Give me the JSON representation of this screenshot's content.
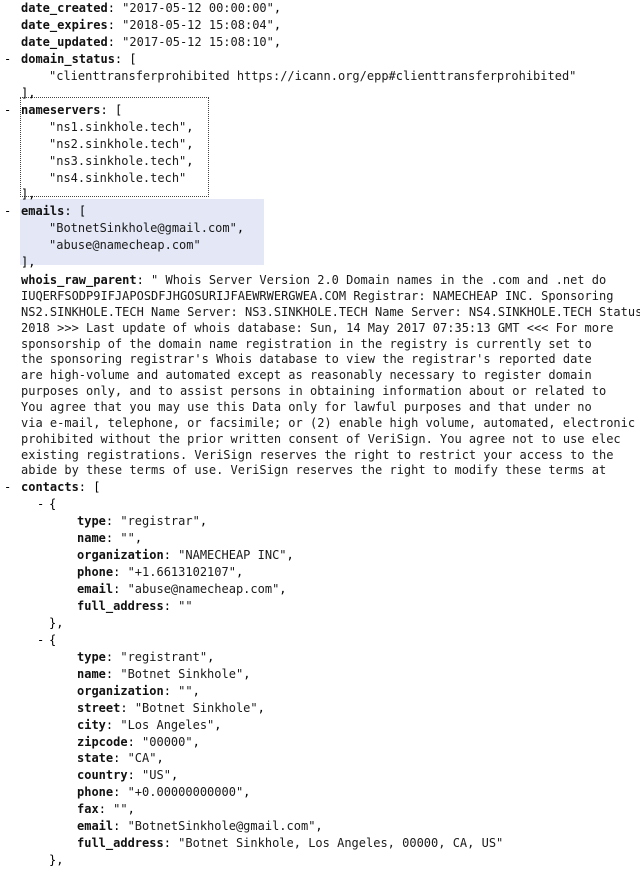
{
  "lines": [
    {
      "i": 0,
      "key": "date_created",
      "val": "\"2017-05-12 00:00:00\"",
      "tail": ","
    },
    {
      "i": 0,
      "key": "date_expires",
      "val": "\"2018-05-12 15:08:04\"",
      "tail": ","
    },
    {
      "i": 0,
      "key": "date_updated",
      "val": "\"2017-05-12 15:08:10\"",
      "tail": ","
    },
    {
      "i": 0,
      "toggle": "-",
      "key": "domain_status",
      "tail": "["
    },
    {
      "i": 1,
      "val": "\"clienttransferprohibited https://icann.org/epp#clienttransferprohibited\""
    },
    {
      "i": 0,
      "tail": "],"
    },
    {
      "i": 0,
      "toggle": "-",
      "key": "nameservers",
      "tail": "["
    },
    {
      "i": 1,
      "val": "\"ns1.sinkhole.tech\"",
      "tail": ","
    },
    {
      "i": 1,
      "val": "\"ns2.sinkhole.tech\"",
      "tail": ","
    },
    {
      "i": 1,
      "val": "\"ns3.sinkhole.tech\"",
      "tail": ","
    },
    {
      "i": 1,
      "val": "\"ns4.sinkhole.tech\""
    },
    {
      "i": 0,
      "tail": "],"
    },
    {
      "i": 0,
      "toggle": "-",
      "key": "emails",
      "tail": "["
    },
    {
      "i": 1,
      "val": "\"BotnetSinkhole@gmail.com\"",
      "tail": ","
    },
    {
      "i": 1,
      "val": "\"abuse@namecheap.com\""
    },
    {
      "i": 0,
      "tail": "],"
    }
  ],
  "raw": {
    "key": "whois_raw_parent",
    "lines": [
      "\" Whois Server Version 2.0 Domain names in the .com and .net do",
      "IUQERFSODP9IFJAPOSDFJHGOSURIJFAEWRWERGWEA.COM Registrar: NAMECHEAP INC. Sponsoring",
      "NS2.SINKHOLE.TECH Name Server: NS3.SINKHOLE.TECH Name Server: NS4.SINKHOLE.TECH Status",
      "2018 >>> Last update of whois database: Sun, 14 May 2017 07:35:13 GMT <<< For more",
      "sponsorship of the domain name registration in the registry is currently set to",
      "the sponsoring registrar's Whois database to view the registrar's reported date",
      "are high-volume and automated except as reasonably necessary to register domain",
      "purposes only, and to assist persons in obtaining information about or related to",
      "You agree that you may use this Data only for lawful purposes and that under no",
      "via e-mail, telephone, or facsimile; or (2) enable high volume, automated, electronic",
      "prohibited without the prior written consent of VeriSign. You agree not to use elec",
      "existing registrations. VeriSign reserves the right to restrict your access to the",
      "abide by these terms of use. VeriSign reserves the right to modify these terms at"
    ]
  },
  "contacts_lines": [
    {
      "i": 0,
      "toggle": "-",
      "key": "contacts",
      "tail": "["
    },
    {
      "i": 1,
      "toggle": "-",
      "tail": "{"
    },
    {
      "i": 2,
      "key": "type",
      "val": "\"registrar\"",
      "tail": ","
    },
    {
      "i": 2,
      "key": "name",
      "val": "\"\"",
      "tail": ","
    },
    {
      "i": 2,
      "key": "organization",
      "val": "\"NAMECHEAP INC\"",
      "tail": ","
    },
    {
      "i": 2,
      "key": "phone",
      "val": "\"+1.6613102107\"",
      "tail": ","
    },
    {
      "i": 2,
      "key": "email",
      "val": "\"abuse@namecheap.com\"",
      "tail": ","
    },
    {
      "i": 2,
      "key": "full_address",
      "val": "\"\""
    },
    {
      "i": 1,
      "tail": "},"
    },
    {
      "i": 1,
      "toggle": "-",
      "tail": "{"
    },
    {
      "i": 2,
      "key": "type",
      "val": "\"registrant\"",
      "tail": ","
    },
    {
      "i": 2,
      "key": "name",
      "val": "\"Botnet Sinkhole\"",
      "tail": ","
    },
    {
      "i": 2,
      "key": "organization",
      "val": "\"\"",
      "tail": ","
    },
    {
      "i": 2,
      "key": "street",
      "val": "\"Botnet Sinkhole\"",
      "tail": ","
    },
    {
      "i": 2,
      "key": "city",
      "val": "\"Los Angeles\"",
      "tail": ","
    },
    {
      "i": 2,
      "key": "zipcode",
      "val": "\"00000\"",
      "tail": ","
    },
    {
      "i": 2,
      "key": "state",
      "val": "\"CA\"",
      "tail": ","
    },
    {
      "i": 2,
      "key": "country",
      "val": "\"US\"",
      "tail": ","
    },
    {
      "i": 2,
      "key": "phone",
      "val": "\"+0.00000000000\"",
      "tail": ","
    },
    {
      "i": 2,
      "key": "fax",
      "val": "\"\"",
      "tail": ","
    },
    {
      "i": 2,
      "key": "email",
      "val": "\"BotnetSinkhole@gmail.com\"",
      "tail": ","
    },
    {
      "i": 2,
      "key": "full_address",
      "val": "\"Botnet Sinkhole, Los Angeles, 00000, CA, US\""
    },
    {
      "i": 1,
      "tail": "},"
    }
  ]
}
